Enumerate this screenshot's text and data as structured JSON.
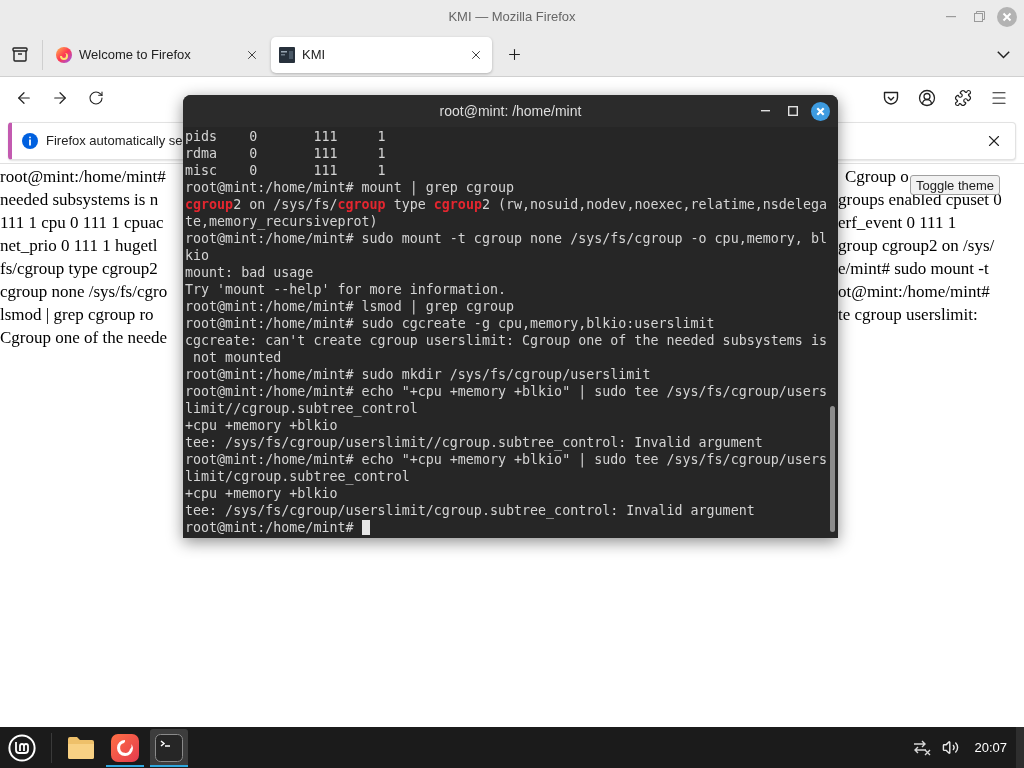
{
  "window": {
    "title": "KMI — Mozilla Firefox"
  },
  "tabs": [
    {
      "kind": "firefox",
      "title": "Welcome to Firefox",
      "selected": false
    },
    {
      "kind": "site",
      "title": "KMI",
      "selected": true
    }
  ],
  "notification": {
    "text": "Firefox automatically se"
  },
  "page": {
    "left_lines": [
      "root@mint:/home/mint#",
      "needed subsystems is n",
      "111 1 cpu 0 111 1 cpuac",
      "net_prio 0 111 1 hugetl",
      "fs/cgroup type cgroup2",
      "cgroup none /sys/fs/cgro",
      "lsmod | grep cgroup ro",
      "Cgroup one of the neede"
    ],
    "right_lines": [
      "Cgroup o",
      "groups enabled cpuset 0",
      "erf_event 0 111 1",
      "group cgroup2 on /sys/",
      "e/mint# sudo mount -t",
      "ot@mint:/home/mint#",
      "te cgroup userslimit:"
    ],
    "tooltip": "Toggle theme"
  },
  "terminal": {
    "title": "root@mint: /home/mint",
    "lines": [
      "pids    0       111     1",
      "rdma    0       111     1",
      "misc    0       111     1",
      "root@mint:/home/mint# mount | grep cgroup",
      [
        {
          "text": "cgroup",
          "match": true
        },
        {
          "text": "2 on /sys/fs/",
          "match": false
        },
        {
          "text": "cgroup",
          "match": true
        },
        {
          "text": " type ",
          "match": false
        },
        {
          "text": "cgroup",
          "match": true
        },
        {
          "text": "2 (rw,nosuid,nodev,noexec,relatime,nsdelega",
          "match": false
        }
      ],
      "te,memory_recursiveprot)",
      "root@mint:/home/mint# sudo mount -t cgroup none /sys/fs/cgroup -o cpu,memory, bl",
      "kio",
      "mount: bad usage",
      "Try 'mount --help' for more information.",
      "root@mint:/home/mint# lsmod | grep cgroup",
      "root@mint:/home/mint# sudo cgcreate -g cpu,memory,blkio:userslimit",
      "cgcreate: can't create cgroup userslimit: Cgroup one of the needed subsystems is",
      " not mounted",
      "root@mint:/home/mint# sudo mkdir /sys/fs/cgroup/userslimit",
      "root@mint:/home/mint# echo \"+cpu +memory +blkio\" | sudo tee /sys/fs/cgroup/users",
      "limit//cgroup.subtree_control",
      "+cpu +memory +blkio",
      "tee: /sys/fs/cgroup/userslimit//cgroup.subtree_control: Invalid argument",
      "root@mint:/home/mint# echo \"+cpu +memory +blkio\" | sudo tee /sys/fs/cgroup/users",
      "limit/cgroup.subtree_control",
      "+cpu +memory +blkio",
      "tee: /sys/fs/cgroup/userslimit/cgroup.subtree_control: Invalid argument"
    ],
    "prompt": "root@mint:/home/mint# ",
    "cursor": true
  },
  "taskbar": {
    "apps": [
      {
        "kind": "files",
        "running": false,
        "selected": false
      },
      {
        "kind": "firefox",
        "running": true,
        "selected": false
      },
      {
        "kind": "terminal",
        "running": true,
        "selected": true
      }
    ],
    "clock": "20:07"
  }
}
